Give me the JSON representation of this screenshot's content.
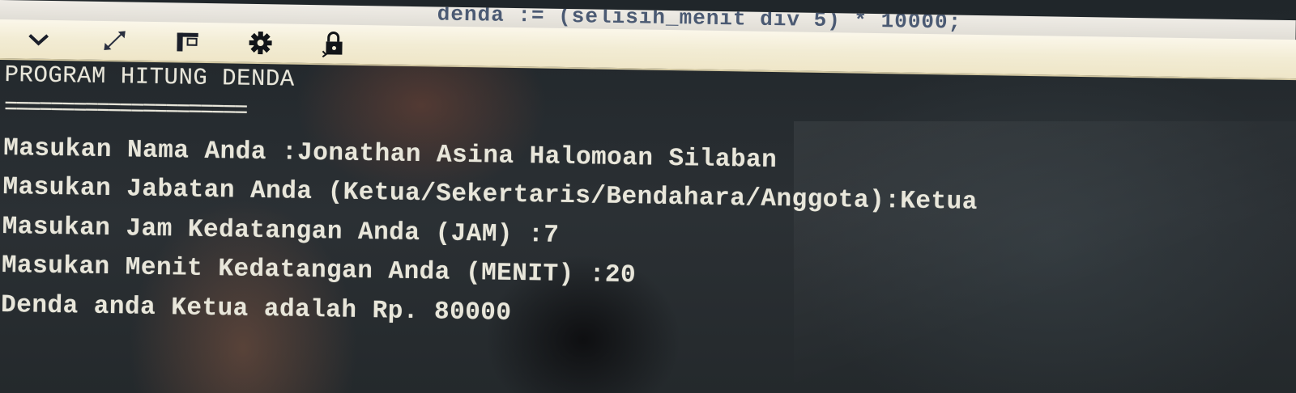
{
  "editor": {
    "code_line": "denda := (selisih_menit div 5) * 10000;"
  },
  "toolbar": {
    "buttons": [
      {
        "name": "collapse",
        "icon": "chevron-down-icon"
      },
      {
        "name": "maximize",
        "icon": "expand-arrows-icon"
      },
      {
        "name": "layout",
        "icon": "panel-layout-icon"
      },
      {
        "name": "settings",
        "icon": "gear-icon"
      },
      {
        "name": "lock",
        "icon": "lock-icon"
      }
    ]
  },
  "console": {
    "title": "PROGRAM HITUNG DENDA",
    "separator": "=====================",
    "lines": [
      "Masukan Nama Anda :Jonathan Asina Halomoan Silaban",
      "Masukan Jabatan Anda (Ketua/Sekertaris/Bendahara/Anggota):Ketua",
      "Masukan Jam Kedatangan Anda (JAM) :7",
      "Masukan Menit Kedatangan Anda (MENIT) :20",
      "Denda anda Ketua adalah Rp. 80000"
    ]
  },
  "colors": {
    "console_background": "#2b3034",
    "console_text": "#e8e6da",
    "toolbar_background": "#f2ecd4"
  }
}
